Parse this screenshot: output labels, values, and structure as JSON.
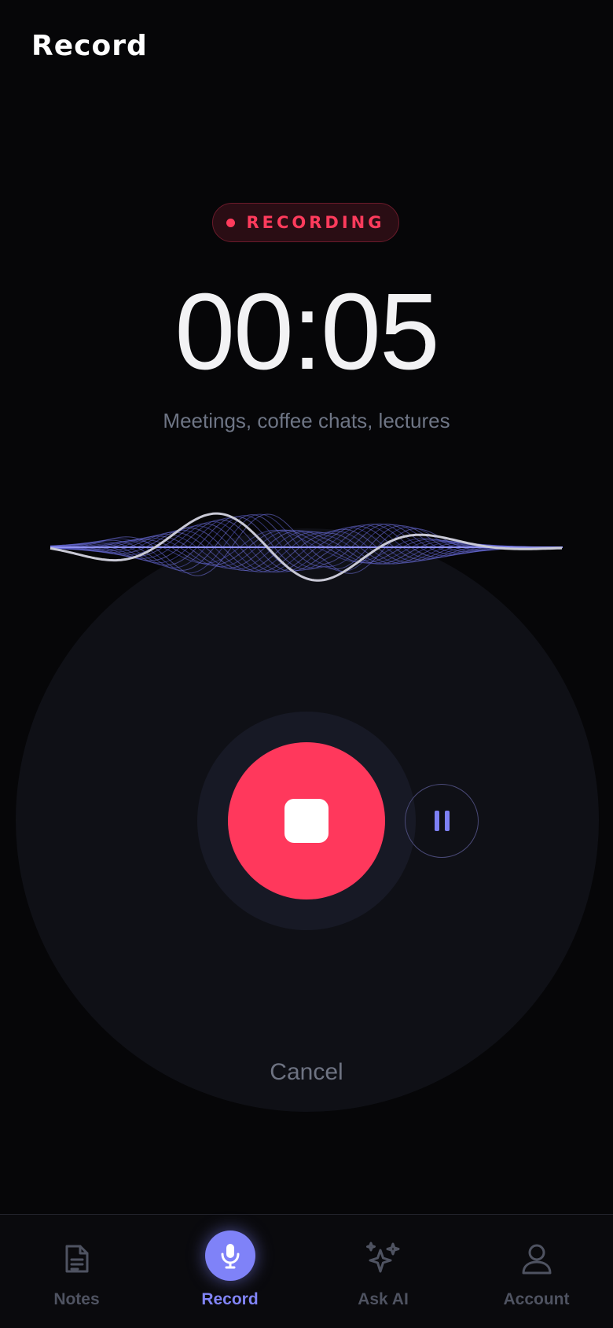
{
  "header": {
    "title": "Record"
  },
  "recording": {
    "status_label": "RECORDING",
    "timer": "00:05",
    "subtitle": "Meetings, coffee chats, lectures",
    "cancel_label": "Cancel"
  },
  "colors": {
    "background": "#060608",
    "accent_red": "#ff385c",
    "accent_purple": "#7f82f8",
    "muted_text": "#6e7585"
  },
  "controls": {
    "stop_icon": "stop-icon",
    "pause_icon": "pause-icon"
  },
  "tabbar": {
    "items": [
      {
        "label": "Notes",
        "icon": "document-icon",
        "active": false
      },
      {
        "label": "Record",
        "icon": "microphone-icon",
        "active": true
      },
      {
        "label": "Ask AI",
        "icon": "sparkles-icon",
        "active": false
      },
      {
        "label": "Account",
        "icon": "user-icon",
        "active": false
      }
    ]
  }
}
